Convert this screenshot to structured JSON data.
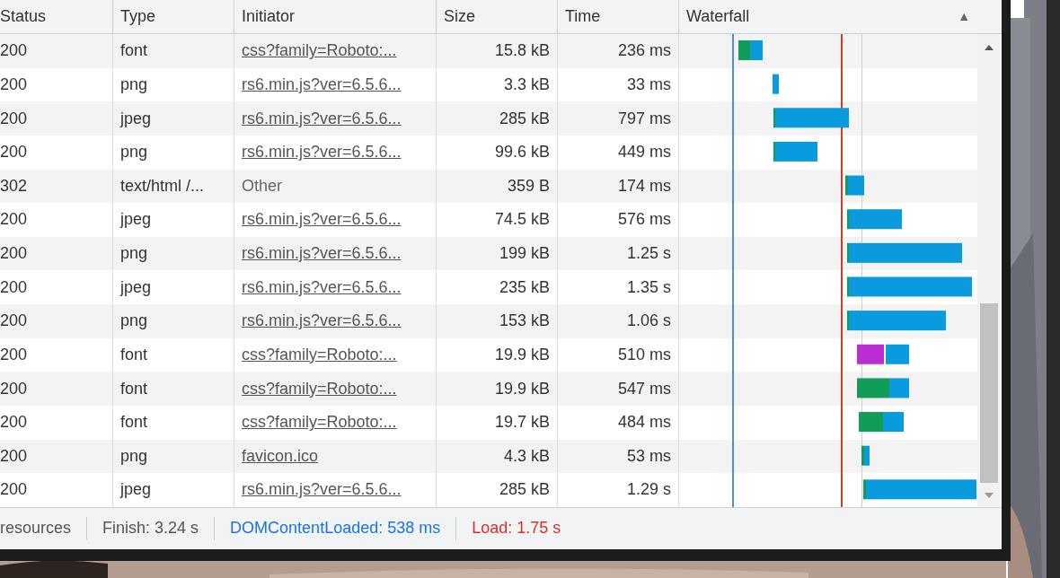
{
  "table": {
    "columns": [
      {
        "label": "Status"
      },
      {
        "label": "Type"
      },
      {
        "label": "Initiator"
      },
      {
        "label": "Size"
      },
      {
        "label": "Time"
      },
      {
        "label": "Waterfall",
        "sort": "▲"
      }
    ],
    "rows": [
      {
        "status": "200",
        "type": "font",
        "initiator": "css?family=Roboto:...",
        "initiator_link": true,
        "size": "15.8 kB",
        "time": "236 ms"
      },
      {
        "status": "200",
        "type": "png",
        "initiator": "rs6.min.js?ver=6.5.6...",
        "initiator_link": true,
        "size": "3.3 kB",
        "time": "33 ms"
      },
      {
        "status": "200",
        "type": "jpeg",
        "initiator": "rs6.min.js?ver=6.5.6...",
        "initiator_link": true,
        "size": "285 kB",
        "time": "797 ms"
      },
      {
        "status": "200",
        "type": "png",
        "initiator": "rs6.min.js?ver=6.5.6...",
        "initiator_link": true,
        "size": "99.6 kB",
        "time": "449 ms"
      },
      {
        "status": "302",
        "type": "text/html /...",
        "initiator": "Other",
        "initiator_link": false,
        "size": "359 B",
        "time": "174 ms"
      },
      {
        "status": "200",
        "type": "jpeg",
        "initiator": "rs6.min.js?ver=6.5.6...",
        "initiator_link": true,
        "size": "74.5 kB",
        "time": "576 ms"
      },
      {
        "status": "200",
        "type": "png",
        "initiator": "rs6.min.js?ver=6.5.6...",
        "initiator_link": true,
        "size": "199 kB",
        "time": "1.25 s"
      },
      {
        "status": "200",
        "type": "jpeg",
        "initiator": "rs6.min.js?ver=6.5.6...",
        "initiator_link": true,
        "size": "235 kB",
        "time": "1.35 s"
      },
      {
        "status": "200",
        "type": "png",
        "initiator": "rs6.min.js?ver=6.5.6...",
        "initiator_link": true,
        "size": "153 kB",
        "time": "1.06 s"
      },
      {
        "status": "200",
        "type": "font",
        "initiator": "css?family=Roboto:...",
        "initiator_link": true,
        "size": "19.9 kB",
        "time": "510 ms"
      },
      {
        "status": "200",
        "type": "font",
        "initiator": "css?family=Roboto:...",
        "initiator_link": true,
        "size": "19.9 kB",
        "time": "547 ms"
      },
      {
        "status": "200",
        "type": "font",
        "initiator": "css?family=Roboto:...",
        "initiator_link": true,
        "size": "19.7 kB",
        "time": "484 ms"
      },
      {
        "status": "200",
        "type": "png",
        "initiator": "favicon.ico",
        "initiator_link": true,
        "size": "4.3 kB",
        "time": "53 ms"
      },
      {
        "status": "200",
        "type": "jpeg",
        "initiator": "rs6.min.js?ver=6.5.6...",
        "initiator_link": true,
        "size": "285 kB",
        "time": "1.29 s"
      }
    ]
  },
  "status_bar": [
    {
      "text": "resources",
      "kind": "plain"
    },
    {
      "text": "Finish: 3.24 s",
      "kind": "plain"
    },
    {
      "text": "DOMContentLoaded: 538 ms",
      "kind": "dom"
    },
    {
      "text": "Load: 1.75 s",
      "kind": "load"
    }
  ]
}
